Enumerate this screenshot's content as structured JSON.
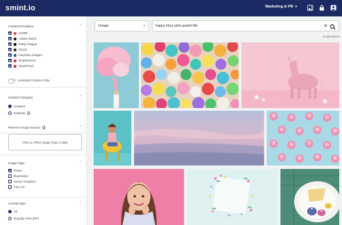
{
  "header": {
    "logo_text": "smint",
    "logo_dot": ".",
    "logo_suffix": "io",
    "workspace": "Marketing & PR",
    "icons": [
      "image-icon",
      "lock-icon",
      "user-icon"
    ],
    "colors": {
      "bar": "#1b2a63"
    }
  },
  "sidebar": {
    "content_providers": {
      "title": "Content Providers",
      "items": [
        {
          "label": "123RF",
          "checked": true,
          "icon_color": "#e94b35"
        },
        {
          "label": "Adobe Stock",
          "checked": true,
          "icon_color": "#2b1e1e"
        },
        {
          "label": "Getty Images",
          "checked": true,
          "icon_color": "#111111"
        },
        {
          "label": "iStock",
          "checked": true,
          "icon_color": "#2c2c2c"
        },
        {
          "label": "mauritius images",
          "checked": true,
          "icon_color": "#1e5c9a"
        },
        {
          "label": "Shutterstock",
          "checked": true,
          "icon_color": "#e2263f"
        },
        {
          "label": "StockFood",
          "checked": true,
          "icon_color": "#d23636"
        }
      ],
      "licensed_toggle_label": "Licensed Content Only"
    },
    "content_category": {
      "title": "Content Category",
      "options": [
        {
          "label": "Creative",
          "selected": true
        },
        {
          "label": "Editorial",
          "selected": false
        }
      ]
    },
    "reverse_search": {
      "title": "Reverse Image Search",
      "dropzone": "PNG or JPEG image (max. 5 MB)"
    },
    "image_type": {
      "title": "Image Type",
      "options": [
        {
          "label": "Photo",
          "checked": true
        },
        {
          "label": "Illustration",
          "checked": false
        },
        {
          "label": "Vector Graphics",
          "checked": false
        },
        {
          "label": "Fine Art",
          "checked": false
        }
      ]
    },
    "license_type": {
      "title": "License type",
      "options": [
        {
          "label": "All",
          "selected": true
        },
        {
          "label": "Royalty-Free (RF)",
          "selected": false
        }
      ]
    }
  },
  "search": {
    "type_value": "Image",
    "query": "happy blue pink pastel life",
    "result_count": "6.453 items"
  },
  "results": [
    "pink-smoke-bottle",
    "colorful-candies",
    "pink-unicorn-toy",
    "woman-yellow-chair",
    "pastel-sky-clouds",
    "pink-macarons-pattern",
    "smiling-woman-portrait",
    "flower-frame-card",
    "plate-with-fruit-tarts"
  ]
}
